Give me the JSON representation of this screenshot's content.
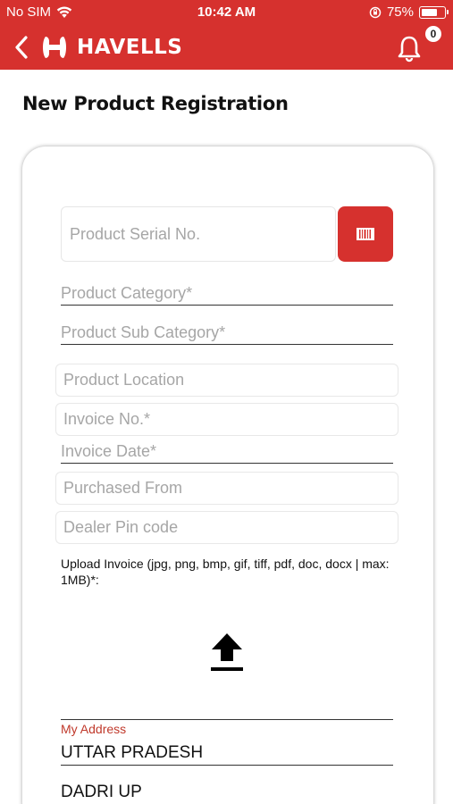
{
  "status_bar": {
    "carrier": "No SIM",
    "time": "10:42 AM",
    "battery_percent": "75%",
    "battery_level": 0.75
  },
  "nav": {
    "brand": "HAVELLS",
    "notification_count": "0",
    "accent_color": "#d6312e"
  },
  "page": {
    "title": "New Product Registration"
  },
  "form": {
    "serial_placeholder": "Product Serial No.",
    "category_placeholder": "Product Category*",
    "sub_category_placeholder": "Product Sub Category*",
    "location_placeholder": "Product Location",
    "invoice_no_placeholder": "Invoice No.*",
    "invoice_date_placeholder": "Invoice Date*",
    "purchased_from_placeholder": "Purchased From",
    "dealer_pin_placeholder": "Dealer Pin code",
    "upload_label": "Upload Invoice (jpg, png, bmp, gif, tiff, pdf, doc, docx | max: 1MB)*:"
  },
  "address": {
    "label": "My Address",
    "state": "UTTAR PRADESH",
    "city": "DADRI UP"
  },
  "icons": {
    "back": "chevron-left-icon",
    "logo": "havells-logo-icon",
    "bell": "bell-icon",
    "scan": "barcode-icon",
    "upload": "upload-icon",
    "wifi": "wifi-icon",
    "orientation_lock": "orientation-lock-icon"
  }
}
